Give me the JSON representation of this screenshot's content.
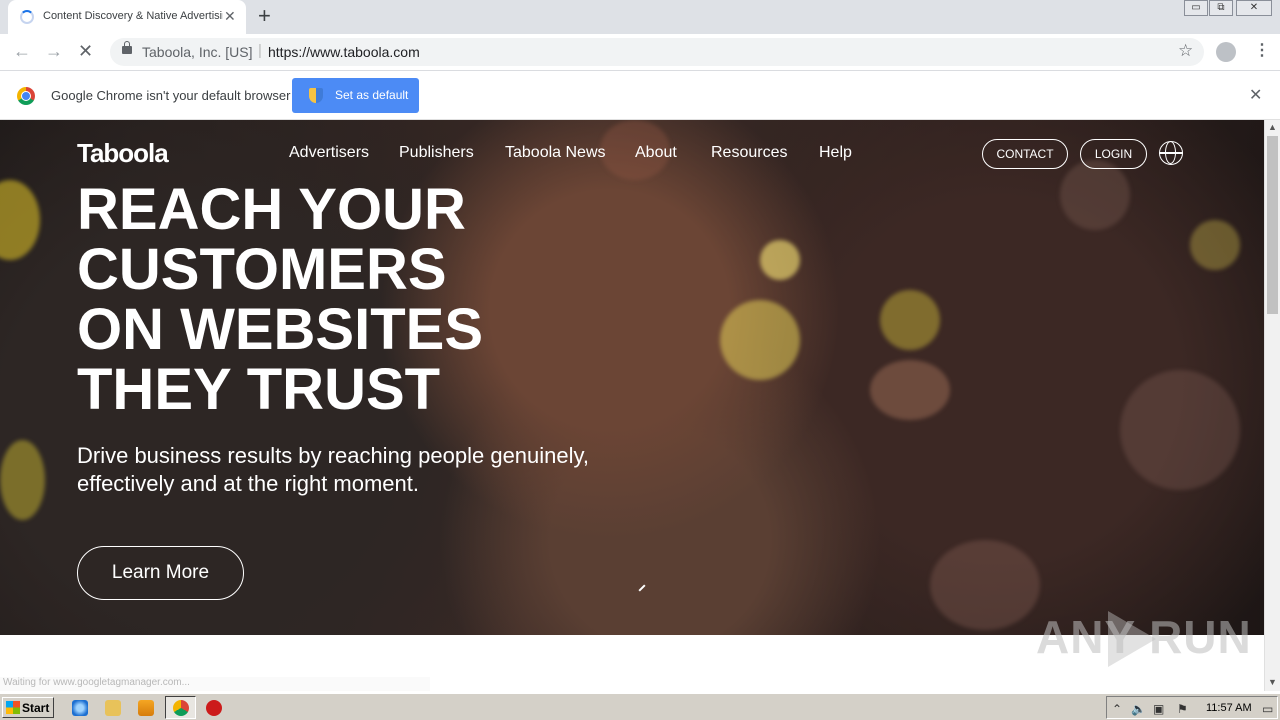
{
  "browser": {
    "tab_title": "Content Discovery & Native Advertising",
    "tab_close": "✕",
    "new_tab": "+",
    "window_controls": [
      "▭",
      "⧉",
      "✕"
    ],
    "site_identity": "Taboola, Inc. [US]",
    "url": "https://www.taboola.com",
    "back_glyph": "←",
    "forward_glyph": "→",
    "stop_glyph": "✕",
    "star_glyph": "☆",
    "menu_glyph": "⋮"
  },
  "infobar": {
    "message": "Google Chrome isn't your default browser",
    "button_label": "Set as default",
    "close_glyph": "✕"
  },
  "site": {
    "logo": "Taboola",
    "nav": [
      "Advertisers",
      "Publishers",
      "Taboola News",
      "About",
      "Resources",
      "Help"
    ],
    "contact_label": "CONTACT",
    "login_label": "LOGIN",
    "headline": [
      "REACH YOUR",
      "CUSTOMERS",
      "ON WEBSITES",
      "THEY TRUST"
    ],
    "subtext": "Drive business results by reaching people genuinely, effectively and at the right moment.",
    "cta_label": "Learn More"
  },
  "status_bar": "Waiting for www.googletagmanager.com...",
  "watermark": "ANY RUN",
  "taskbar": {
    "start_label": "Start",
    "clock": "11:57 AM"
  },
  "colors": {
    "chrome_tabstrip": "#dee1e6",
    "infobar_button": "#4c8bf5",
    "taskbar": "#d4d0c8"
  }
}
